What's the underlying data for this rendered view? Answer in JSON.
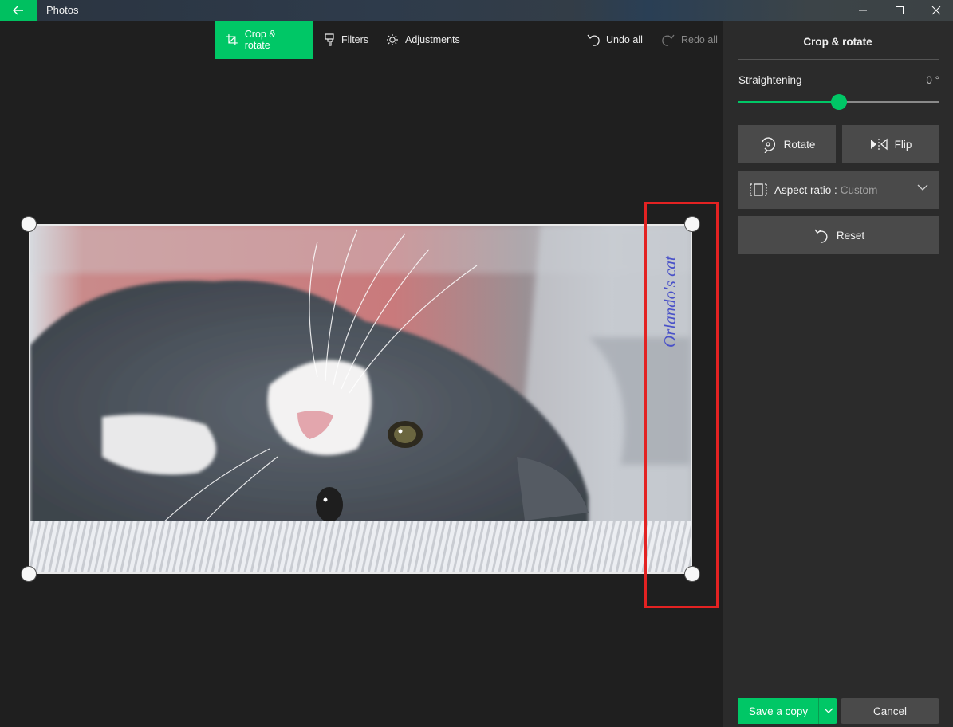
{
  "window": {
    "app_title": "Photos",
    "back_icon": "back-arrow-icon",
    "controls": [
      "minimize-icon",
      "maximize-icon",
      "close-icon"
    ]
  },
  "toolbar": {
    "tabs": [
      {
        "label": "Crop & rotate",
        "icon": "crop-icon",
        "active": true
      },
      {
        "label": "Filters",
        "icon": "filter-brush-icon",
        "active": false
      },
      {
        "label": "Adjustments",
        "icon": "brightness-icon",
        "active": false
      }
    ],
    "undo_all": "Undo all",
    "redo_all": "Redo all",
    "redo_enabled": false
  },
  "canvas": {
    "watermark_text": "Orlando's cat",
    "image_description": "Grey and white cat lying on its side on a white ribbed blanket, pink background",
    "highlight_color": "#e32222"
  },
  "panel": {
    "title": "Crop & rotate",
    "straightening": {
      "label": "Straightening",
      "value_text": "0 °",
      "value_degrees": 0,
      "slider_fraction": 0.5
    },
    "rotate_label": "Rotate",
    "flip_label": "Flip",
    "aspect_ratio": {
      "label": "Aspect ratio :",
      "value": "Custom"
    },
    "reset_label": "Reset"
  },
  "footer": {
    "save_label": "Save a copy",
    "cancel_label": "Cancel"
  },
  "colors": {
    "accent": "#00c766",
    "background": "#1f1f1f",
    "panel": "#2b2b2b",
    "button": "#4a4a4a"
  }
}
